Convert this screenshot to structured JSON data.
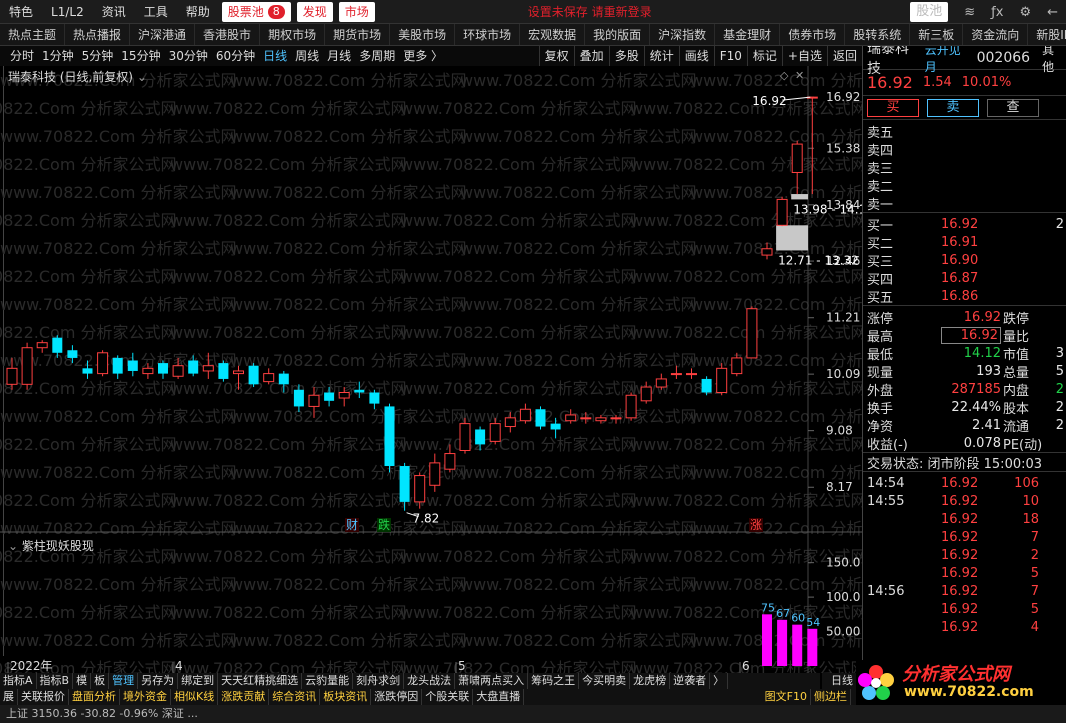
{
  "menubar": {
    "items": [
      "特色",
      "L1/L2",
      "资讯",
      "工具",
      "帮助"
    ],
    "stockpool_label": "股票池",
    "stockpool_count": "8",
    "discover_label": "发现",
    "market_label": "市场",
    "alert_text": "设置未保存 请重新登录",
    "pool_right_label": "股池"
  },
  "navbar": {
    "items": [
      "热点主题",
      "热点播报",
      "沪深港通",
      "香港股市",
      "期权市场",
      "期货市场",
      "美股市场",
      "环球市场",
      "宏观数据",
      "我的版面",
      "沪深指数",
      "基金理财",
      "债券市场",
      "股转系统",
      "新三板",
      "资金流向",
      "新股IPO"
    ]
  },
  "chartbar": {
    "periods": [
      "分时",
      "1分钟",
      "5分钟",
      "15分钟",
      "30分钟",
      "60分钟",
      "日线",
      "周线",
      "月线",
      "多周期",
      "更多 〉"
    ],
    "active_period": "日线",
    "tools": [
      "复权",
      "叠加",
      "多股",
      "统计",
      "画线",
      "F10",
      "标记",
      "+自选",
      "返回"
    ]
  },
  "chart": {
    "stock_title": "瑞泰科技 (日线,前复权)",
    "indicator_title": "紫柱现妖股现",
    "watermark": "www.70822.Com 分析家公式网",
    "high_label": "16.92",
    "low_label": "7.82",
    "gap1_label": "13.98 - 14.12",
    "gap2_label": "12.71 - 13.32",
    "markers": [
      {
        "text": "财",
        "color": "#4fc3ff"
      },
      {
        "text": "跌",
        "color": "#21d14a"
      },
      {
        "text": "涨",
        "color": "#ff4040"
      }
    ],
    "x_labels": [
      "2022年",
      "4",
      "5",
      "6"
    ],
    "period_label": "日线"
  },
  "chart_data": {
    "type": "candlestick",
    "y_ticks": [
      "16.92",
      "15.38",
      "13.84",
      "12.46",
      "11.21",
      "10.09",
      "9.08",
      "8.17"
    ],
    "y_scale": "log",
    "ylim": [
      7.6,
      17.6
    ],
    "candles": [
      {
        "o": 9.9,
        "c": 10.2,
        "h": 10.4,
        "l": 9.8
      },
      {
        "o": 9.9,
        "c": 10.6,
        "h": 10.7,
        "l": 9.8
      },
      {
        "o": 10.6,
        "c": 10.7,
        "h": 10.75,
        "l": 10.5
      },
      {
        "o": 10.8,
        "c": 10.5,
        "h": 10.85,
        "l": 10.4
      },
      {
        "o": 10.55,
        "c": 10.4,
        "h": 10.65,
        "l": 10.3
      },
      {
        "o": 10.2,
        "c": 10.1,
        "h": 10.35,
        "l": 10.0
      },
      {
        "o": 10.1,
        "c": 10.5,
        "h": 10.55,
        "l": 10.05
      },
      {
        "o": 10.4,
        "c": 10.1,
        "h": 10.45,
        "l": 10.0
      },
      {
        "o": 10.35,
        "c": 10.15,
        "h": 10.5,
        "l": 10.05
      },
      {
        "o": 10.1,
        "c": 10.2,
        "h": 10.3,
        "l": 10.0
      },
      {
        "o": 10.3,
        "c": 10.1,
        "h": 10.35,
        "l": 10.0
      },
      {
        "o": 10.05,
        "c": 10.25,
        "h": 10.4,
        "l": 10.0
      },
      {
        "o": 10.35,
        "c": 10.1,
        "h": 10.45,
        "l": 10.05
      },
      {
        "o": 10.15,
        "c": 10.25,
        "h": 10.5,
        "l": 10.0
      },
      {
        "o": 10.3,
        "c": 10.0,
        "h": 10.35,
        "l": 9.95
      },
      {
        "o": 10.1,
        "c": 10.15,
        "h": 10.25,
        "l": 9.8
      },
      {
        "o": 10.25,
        "c": 9.9,
        "h": 10.3,
        "l": 9.85
      },
      {
        "o": 9.95,
        "c": 10.1,
        "h": 10.2,
        "l": 9.9
      },
      {
        "o": 10.1,
        "c": 9.9,
        "h": 10.15,
        "l": 9.75
      },
      {
        "o": 9.8,
        "c": 9.5,
        "h": 9.9,
        "l": 9.4
      },
      {
        "o": 9.5,
        "c": 9.7,
        "h": 9.85,
        "l": 9.3
      },
      {
        "o": 9.75,
        "c": 9.6,
        "h": 9.85,
        "l": 9.5
      },
      {
        "o": 9.65,
        "c": 9.75,
        "h": 9.85,
        "l": 9.5
      },
      {
        "o": 9.8,
        "c": 9.75,
        "h": 9.95,
        "l": 9.65
      },
      {
        "o": 9.75,
        "c": 9.55,
        "h": 9.8,
        "l": 9.45
      },
      {
        "o": 9.5,
        "c": 8.5,
        "h": 9.55,
        "l": 8.4
      },
      {
        "o": 8.5,
        "c": 7.95,
        "h": 8.55,
        "l": 7.82
      },
      {
        "o": 7.95,
        "c": 8.35,
        "h": 8.4,
        "l": 7.85
      },
      {
        "o": 8.2,
        "c": 8.55,
        "h": 8.7,
        "l": 8.1
      },
      {
        "o": 8.45,
        "c": 8.7,
        "h": 8.85,
        "l": 8.4
      },
      {
        "o": 8.75,
        "c": 9.2,
        "h": 9.3,
        "l": 8.7
      },
      {
        "o": 9.1,
        "c": 8.85,
        "h": 9.15,
        "l": 8.75
      },
      {
        "o": 8.9,
        "c": 9.2,
        "h": 9.3,
        "l": 8.85
      },
      {
        "o": 9.15,
        "c": 9.3,
        "h": 9.4,
        "l": 9.05
      },
      {
        "o": 9.25,
        "c": 9.45,
        "h": 9.55,
        "l": 9.2
      },
      {
        "o": 9.45,
        "c": 9.15,
        "h": 9.5,
        "l": 9.1
      },
      {
        "o": 9.2,
        "c": 9.1,
        "h": 9.3,
        "l": 8.95
      },
      {
        "o": 9.25,
        "c": 9.35,
        "h": 9.45,
        "l": 9.2
      },
      {
        "o": 9.3,
        "c": 9.3,
        "h": 9.4,
        "l": 9.2
      },
      {
        "o": 9.25,
        "c": 9.3,
        "h": 9.35,
        "l": 9.2
      },
      {
        "o": 9.3,
        "c": 9.3,
        "h": 9.35,
        "l": 9.2
      },
      {
        "o": 9.3,
        "c": 9.7,
        "h": 9.75,
        "l": 9.25
      },
      {
        "o": 9.6,
        "c": 9.85,
        "h": 9.95,
        "l": 9.55
      },
      {
        "o": 9.85,
        "c": 10.0,
        "h": 10.1,
        "l": 9.8
      },
      {
        "o": 10.1,
        "c": 10.1,
        "h": 10.25,
        "l": 10.0
      },
      {
        "o": 10.1,
        "c": 10.1,
        "h": 10.2,
        "l": 10.0
      },
      {
        "o": 10.0,
        "c": 9.75,
        "h": 10.05,
        "l": 9.7
      },
      {
        "o": 9.75,
        "c": 10.2,
        "h": 10.3,
        "l": 9.7
      },
      {
        "o": 10.1,
        "c": 10.4,
        "h": 10.5,
        "l": 10.05
      },
      {
        "o": 10.4,
        "c": 11.4,
        "h": 11.45,
        "l": 10.4
      },
      {
        "o": 12.6,
        "c": 12.75,
        "h": 12.9,
        "l": 12.5
      },
      {
        "o": 13.32,
        "c": 13.98,
        "h": 14.05,
        "l": 13.3
      },
      {
        "o": 14.7,
        "c": 15.5,
        "h": 15.6,
        "l": 14.12
      },
      {
        "o": 16.92,
        "c": 16.92,
        "h": 16.92,
        "l": 14.12
      }
    ],
    "indicator": {
      "y_ticks": [
        "150.0",
        "100.0",
        "50.00"
      ],
      "ylim": [
        0,
        180
      ],
      "bars": [
        75,
        67,
        60,
        54
      ],
      "bar_labels": [
        "75",
        "67",
        "60",
        "54"
      ],
      "bar_color": "#ff00ff"
    }
  },
  "rightpanel": {
    "name": "瑞泰科技",
    "sub": "云开见月",
    "code": "002066",
    "more": "其他",
    "price": "16.92",
    "change": "1.54",
    "pct": "10.01%",
    "buy_label": "买",
    "sell_label": "卖",
    "query_label": "查",
    "asks": [
      {
        "label": "卖五",
        "price": "",
        "vol": ""
      },
      {
        "label": "卖四",
        "price": "",
        "vol": ""
      },
      {
        "label": "卖三",
        "price": "",
        "vol": ""
      },
      {
        "label": "卖二",
        "price": "",
        "vol": ""
      },
      {
        "label": "卖一",
        "price": "",
        "vol": ""
      }
    ],
    "bids": [
      {
        "label": "买一",
        "price": "16.92",
        "vol": "2"
      },
      {
        "label": "买二",
        "price": "16.91",
        "vol": ""
      },
      {
        "label": "买三",
        "price": "16.90",
        "vol": ""
      },
      {
        "label": "买四",
        "price": "16.87",
        "vol": ""
      },
      {
        "label": "买五",
        "price": "16.86",
        "vol": ""
      }
    ],
    "stats": [
      {
        "l1": "涨停",
        "v1": "16.92",
        "c1": "red",
        "l2": "跌停",
        "v2": ""
      },
      {
        "l1": "最高",
        "v1": "16.92",
        "c1": "red",
        "l2": "量比",
        "v2": ""
      },
      {
        "l1": "最低",
        "v1": "14.12",
        "c1": "green",
        "l2": "市值",
        "v2": "3"
      },
      {
        "l1": "现量",
        "v1": "193",
        "c1": "white",
        "l2": "总量",
        "v2": "5"
      },
      {
        "l1": "外盘",
        "v1": "287185",
        "c1": "red",
        "l2": "内盘",
        "v2": "2"
      },
      {
        "l1": "换手",
        "v1": "22.44%",
        "c1": "white",
        "l2": "股本",
        "v2": "2"
      },
      {
        "l1": "净资",
        "v1": "2.41",
        "c1": "white",
        "l2": "流通",
        "v2": "2"
      },
      {
        "l1": "收益(-)",
        "v1": "0.078",
        "c1": "white",
        "l2": "PE(动)",
        "v2": ""
      }
    ],
    "phase": "交易状态: 闭市阶段 15:00:03",
    "ticks": [
      {
        "t": "14:54",
        "p": "16.92",
        "v": "106"
      },
      {
        "t": "14:55",
        "p": "16.92",
        "v": "10"
      },
      {
        "t": "",
        "p": "16.92",
        "v": "18"
      },
      {
        "t": "",
        "p": "16.92",
        "v": "7"
      },
      {
        "t": "",
        "p": "16.92",
        "v": "2"
      },
      {
        "t": "",
        "p": "16.92",
        "v": "5"
      },
      {
        "t": "14:56",
        "p": "16.92",
        "v": "7"
      },
      {
        "t": "",
        "p": "16.92",
        "v": "5"
      },
      {
        "t": "",
        "p": "16.92",
        "v": "4"
      }
    ]
  },
  "indtabs": {
    "items": [
      "指标A",
      "指标B",
      "模",
      "板",
      "管理",
      "另存为",
      "绑定到",
      "天天红精挑细选",
      "云豹量能",
      "刻舟求剑",
      "龙头战法",
      "萧啸两点买入",
      "筹码之王",
      "今买明卖",
      "龙虎榜",
      "逆袭者",
      "〉"
    ],
    "active": "管理"
  },
  "bottombar": {
    "items": [
      "展",
      "关联报价",
      "盘面分析",
      "境外资金",
      "相似K线",
      "涨跌贡献",
      "综合资讯",
      "板块资讯",
      "涨跌停因",
      "个股关联",
      "大盘直播"
    ],
    "right": [
      "图文F10",
      "侧边栏"
    ]
  },
  "statusbar": {
    "text": "上证 3150.36  -30.82  -0.96%    深证 ..."
  },
  "logo": {
    "text": "分析家公式网",
    "url": "www.70822.com"
  }
}
